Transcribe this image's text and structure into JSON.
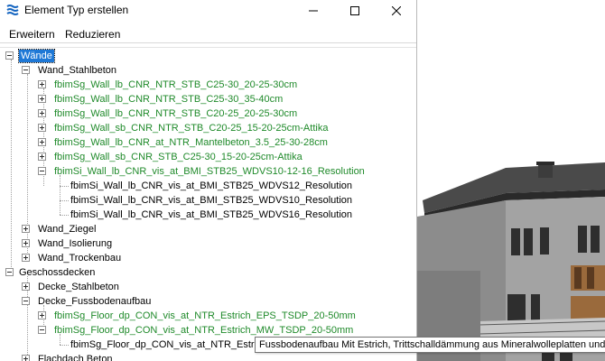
{
  "window": {
    "title": "Element Typ erstellen",
    "buttons": {
      "minimize": "minimize-icon",
      "maximize": "maximize-icon",
      "close": "close-icon"
    }
  },
  "menu": {
    "expand_label": "Erweitern",
    "collapse_label": "Reduzieren"
  },
  "tree": {
    "walls": {
      "label": "Wände",
      "groups": {
        "concrete": {
          "label": "Wand_Stahlbeton",
          "items": [
            "fbimSg_Wall_lb_CNR_NTR_STB_C25-30_20-25-30cm",
            "fbimSg_Wall_lb_CNR_NTR_STB_C25-30_35-40cm",
            "fbimSg_Wall_lb_CNR_NTR_STB_C20-25_20-25-30cm",
            "fbimSg_Wall_sb_CNR_NTR_STB_C20-25_15-20-25cm-Attika",
            "fbimSg_Wall_lb_CNR_at_NTR_Mantelbeton_3.5_25-30-28cm",
            "fbimSg_Wall_sb_CNR_STB_C25-30_15-20-25cm-Attika",
            "fbimSi_Wall_lb_CNR_vis_at_BMI_STB25_WDVS10-12-16_Resolution"
          ],
          "subitems": [
            "fbimSi_Wall_lb_CNR_vis_at_BMI_STB25_WDVS12_Resolution",
            "fbimSi_Wall_lb_CNR_vis_at_BMI_STB25_WDVS10_Resolution",
            "fbimSi_Wall_lb_CNR_vis_at_BMI_STB25_WDVS16_Resolution"
          ]
        },
        "brick": "Wand_Ziegel",
        "insulation": "Wand_Isolierung",
        "drywall": "Wand_Trockenbau"
      }
    },
    "floors": {
      "label": "Geschossdecken",
      "groups": {
        "concrete": "Decke_Stahlbeton",
        "buildup": {
          "label": "Decke_Fussbodenaufbau",
          "items": [
            "fbimSg_Floor_dp_CON_vis_at_NTR_Estrich_EPS_TSDP_20-50mm",
            "fbimSg_Floor_dp_CON_vis_at_NTR_Estrich_MW_TSDP_20-50mm"
          ],
          "subitems": [
            "fbimSg_Floor_dp_CON_vis_at_NTR_Estrich"
          ]
        },
        "flatroof": "Flachdach Beton"
      }
    }
  },
  "tooltip": "Fussbodenaufbau Mit Estrich, Trittschalldämmung aus Mineralwolleplatten und Bel",
  "colors": {
    "selection": "#1e78d6",
    "type_text": "#1f8a2a",
    "app_icon": "#1565c0"
  }
}
